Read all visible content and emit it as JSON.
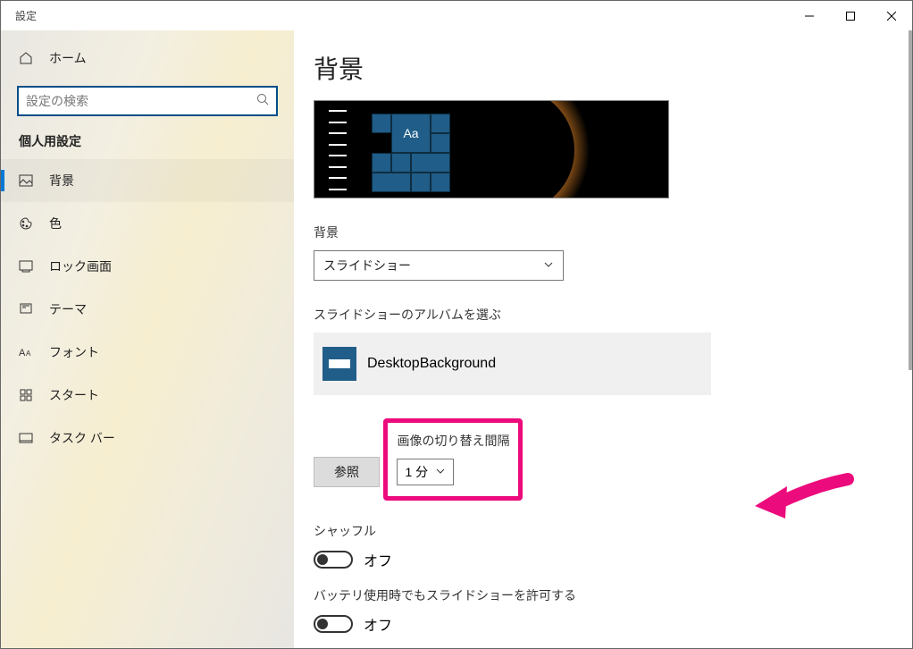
{
  "window": {
    "title": "設定"
  },
  "sidebar": {
    "home": "ホーム",
    "search_placeholder": "設定の検索",
    "category": "個人用設定",
    "items": [
      {
        "label": "背景"
      },
      {
        "label": "色"
      },
      {
        "label": "ロック画面"
      },
      {
        "label": "テーマ"
      },
      {
        "label": "フォント"
      },
      {
        "label": "スタート"
      },
      {
        "label": "タスク バー"
      }
    ]
  },
  "main": {
    "page_title": "背景",
    "preview_aa": "Aa",
    "bg_label": "背景",
    "bg_value": "スライドショー",
    "album_label": "スライドショーのアルバムを選ぶ",
    "album_folder": "DesktopBackground",
    "browse_btn": "参照",
    "interval_label": "画像の切り替え間隔",
    "interval_value": "1 分",
    "shuffle_label": "シャッフル",
    "shuffle_state": "オフ",
    "battery_label": "バッテリ使用時でもスライドショーを許可する",
    "battery_state": "オフ"
  }
}
